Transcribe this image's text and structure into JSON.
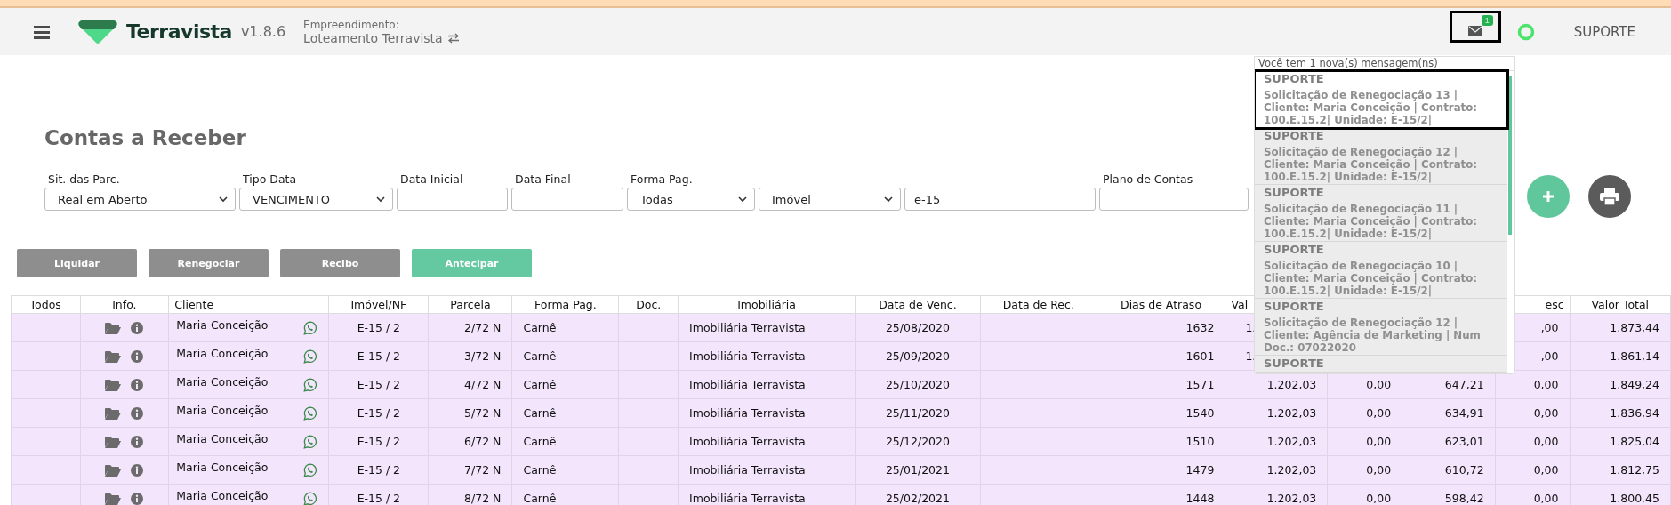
{
  "header": {
    "brand": "Terravista",
    "version": "v1.8.6",
    "project_label": "Empreendimento:",
    "project_name": "Loteamento Terravista",
    "message_count": "1",
    "message_button_highlighted": true,
    "user": "SUPORTE"
  },
  "page_title": "Contas a Receber",
  "filters": [
    {
      "kind": "select",
      "label": "Sit. das Parc.",
      "value": "Real em Aberto"
    },
    {
      "kind": "select",
      "label": "Tipo Data",
      "value": "VENCIMENTO"
    },
    {
      "kind": "input",
      "label": "Data Inicial"
    },
    {
      "kind": "input",
      "label": "Data Final"
    },
    {
      "kind": "select",
      "label": "Forma Pag.",
      "value": "Todas"
    },
    {
      "kind": "select",
      "value": "Imóvel"
    },
    {
      "kind": "input",
      "value": "e-15"
    },
    {
      "kind": "input",
      "label": "Plano de Contas"
    }
  ],
  "actions": [
    {
      "label": "Liquidar",
      "kind": "secondary"
    },
    {
      "label": "Renegociar",
      "kind": "secondary"
    },
    {
      "label": "Recibo",
      "kind": "secondary"
    },
    {
      "label": "Antecipar",
      "kind": "primary"
    }
  ],
  "table": {
    "columns": {
      "select": "Todos",
      "info": "Info.",
      "client": "Cliente",
      "property": "Imóvel/NF",
      "installment": "Parcela",
      "payment_method": "Forma Pag.",
      "document": "Doc.",
      "agency": "Imobiliária",
      "due_date": "Data de Venc.",
      "received_date": "Data de Rec.",
      "days_late": "Dias de Atraso",
      "column_9": "Val",
      "column_12": "esc",
      "total": "Valor Total"
    },
    "rows": [
      {
        "client": "Maria Conceição",
        "property": "E-15 / 2",
        "installment": "2/72 N",
        "payment_method": "Carnê",
        "agency": "Imobiliária Terravista",
        "due_date": "25/08/2020",
        "days_late": "1632",
        "column_9": "1.",
        "column_12": ",00",
        "total": "1.873,44"
      },
      {
        "client": "Maria Conceição",
        "property": "E-15 / 2",
        "installment": "3/72 N",
        "payment_method": "Carnê",
        "agency": "Imobiliária Terravista",
        "due_date": "25/09/2020",
        "days_late": "1601",
        "column_9": "1.",
        "column_12": ",00",
        "total": "1.861,14"
      },
      {
        "client": "Maria Conceição",
        "property": "E-15 / 2",
        "installment": "4/72 N",
        "payment_method": "Carnê",
        "agency": "Imobiliária Terravista",
        "due_date": "25/10/2020",
        "days_late": "1571",
        "column_9": "1.202,03",
        "column_10": "0,00",
        "column_11": "647,21",
        "column_12": "0,00",
        "total": "1.849,24"
      },
      {
        "client": "Maria Conceição",
        "property": "E-15 / 2",
        "installment": "5/72 N",
        "payment_method": "Carnê",
        "agency": "Imobiliária Terravista",
        "due_date": "25/11/2020",
        "days_late": "1540",
        "column_9": "1.202,03",
        "column_10": "0,00",
        "column_11": "634,91",
        "column_12": "0,00",
        "total": "1.836,94"
      },
      {
        "client": "Maria Conceição",
        "property": "E-15 / 2",
        "installment": "6/72 N",
        "payment_method": "Carnê",
        "agency": "Imobiliária Terravista",
        "due_date": "25/12/2020",
        "days_late": "1510",
        "column_9": "1.202,03",
        "column_10": "0,00",
        "column_11": "623,01",
        "column_12": "0,00",
        "total": "1.825,04"
      },
      {
        "client": "Maria Conceição",
        "property": "E-15 / 2",
        "installment": "7/72 N",
        "payment_method": "Carnê",
        "agency": "Imobiliária Terravista",
        "due_date": "25/01/2021",
        "days_late": "1479",
        "column_9": "1.202,03",
        "column_10": "0,00",
        "column_11": "610,72",
        "column_12": "0,00",
        "total": "1.812,75"
      },
      {
        "client": "Maria Conceição",
        "property": "E-15 / 2",
        "installment": "8/72 N",
        "payment_method": "Carnê",
        "agency": "Imobiliária Terravista",
        "due_date": "25/02/2021",
        "days_late": "1448",
        "column_9": "1.202,03",
        "column_10": "0,00",
        "column_11": "598,42",
        "column_12": "0,00",
        "total": "1.800,45"
      }
    ]
  },
  "notifications": {
    "summary": "Você tem 1 nova(s) mensagem(ns)",
    "messages": [
      {
        "sender": "SUPORTE",
        "text": "Solicitação de Renegociação 13 | Cliente: Maria Conceição | Contrato: 100.E.15.2| Unidade: E-15/2|",
        "highlighted": true
      },
      {
        "sender": "SUPORTE",
        "text": "Solicitação de Renegociação 12 | Cliente: Maria Conceição | Contrato: 100.E.15.2| Unidade: E-15/2|",
        "highlighted": false
      },
      {
        "sender": "SUPORTE",
        "text": "Solicitação de Renegociação 11 | Cliente: Maria Conceição | Contrato: 100.E.15.2| Unidade: E-15/2|",
        "highlighted": false
      },
      {
        "sender": "SUPORTE",
        "text": "Solicitação de Renegociação 10 | Cliente: Maria Conceição | Contrato: 100.E.15.2| Unidade: E-15/2|",
        "highlighted": false
      },
      {
        "sender": "SUPORTE",
        "text": "Solicitação de Renegociação 12 | Cliente: Agência de Marketing | Num Doc.: 07022020",
        "highlighted": false
      },
      {
        "sender": "SUPORTE",
        "highlighted": false
      }
    ]
  }
}
